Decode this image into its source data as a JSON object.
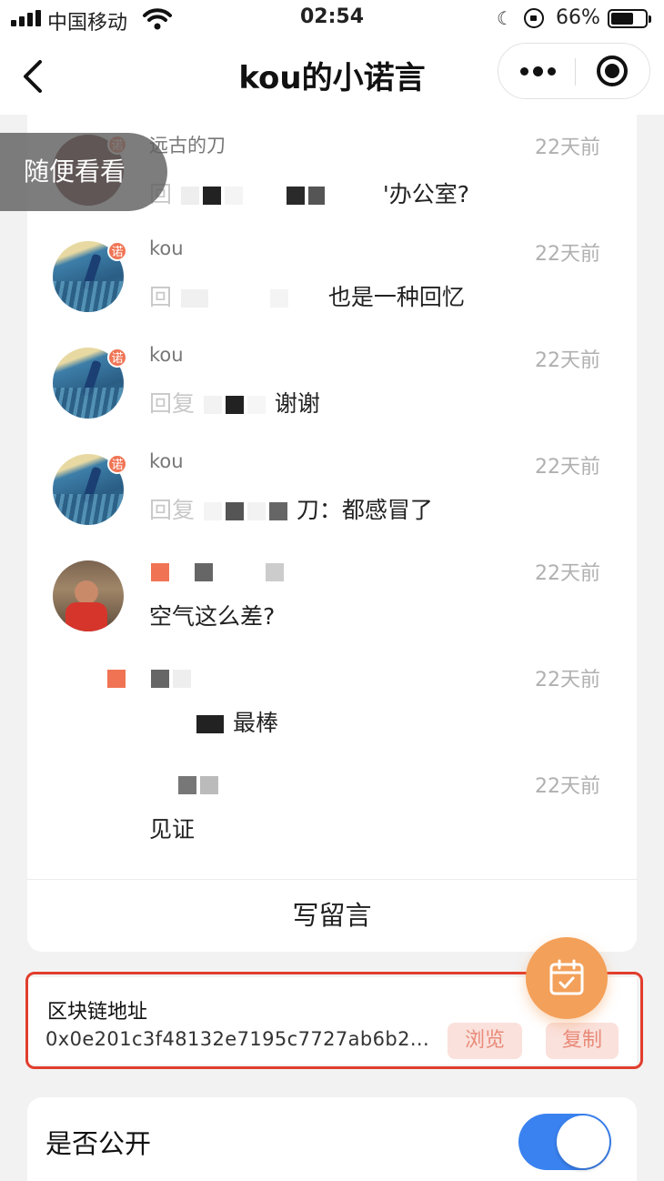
{
  "status_bar": {
    "carrier": "中国移动",
    "time": "02:54",
    "battery_percent": "66%",
    "battery_level": 0.66
  },
  "nav": {
    "title": "kou的小诺言"
  },
  "overlay": {
    "browse_label": "随便看看"
  },
  "comments": [
    {
      "name": "远古的刀",
      "time": "22天前",
      "reply": "回",
      "text": "'办公室?",
      "badge": "诺"
    },
    {
      "name": "kou",
      "time": "22天前",
      "reply": "回",
      "text": "也是一种回忆",
      "badge": "诺"
    },
    {
      "name": "kou",
      "time": "22天前",
      "reply": "回复",
      "text": "谢谢",
      "badge": "诺"
    },
    {
      "name": "kou",
      "time": "22天前",
      "reply": "回复",
      "text": "刀：都感冒了",
      "badge": "诺"
    },
    {
      "name": "",
      "time": "22天前",
      "reply": "",
      "text": "空气这么差?"
    },
    {
      "name": "",
      "time": "22天前",
      "reply": "",
      "text": "最棒"
    },
    {
      "name": "",
      "time": "22天前",
      "reply": "",
      "text": "见证"
    }
  ],
  "write_comment_label": "写留言",
  "blockchain": {
    "label": "区块链地址",
    "address": "0x0e201c3f48132e7195c7727ab6b2...",
    "browse_label": "浏览",
    "copy_label": "复制"
  },
  "public_setting": {
    "label": "是否公开",
    "enabled": true
  },
  "colors": {
    "accent_orange": "#f3a05a",
    "highlight_red": "#e23d2d",
    "toggle_blue": "#3a82f0",
    "chip_bg": "#fae1dc",
    "chip_text": "#e98a78"
  },
  "icons": {
    "back": "chevron-left-icon",
    "more": "more-dots-icon",
    "close": "target-icon",
    "fab": "calendar-check-icon"
  }
}
